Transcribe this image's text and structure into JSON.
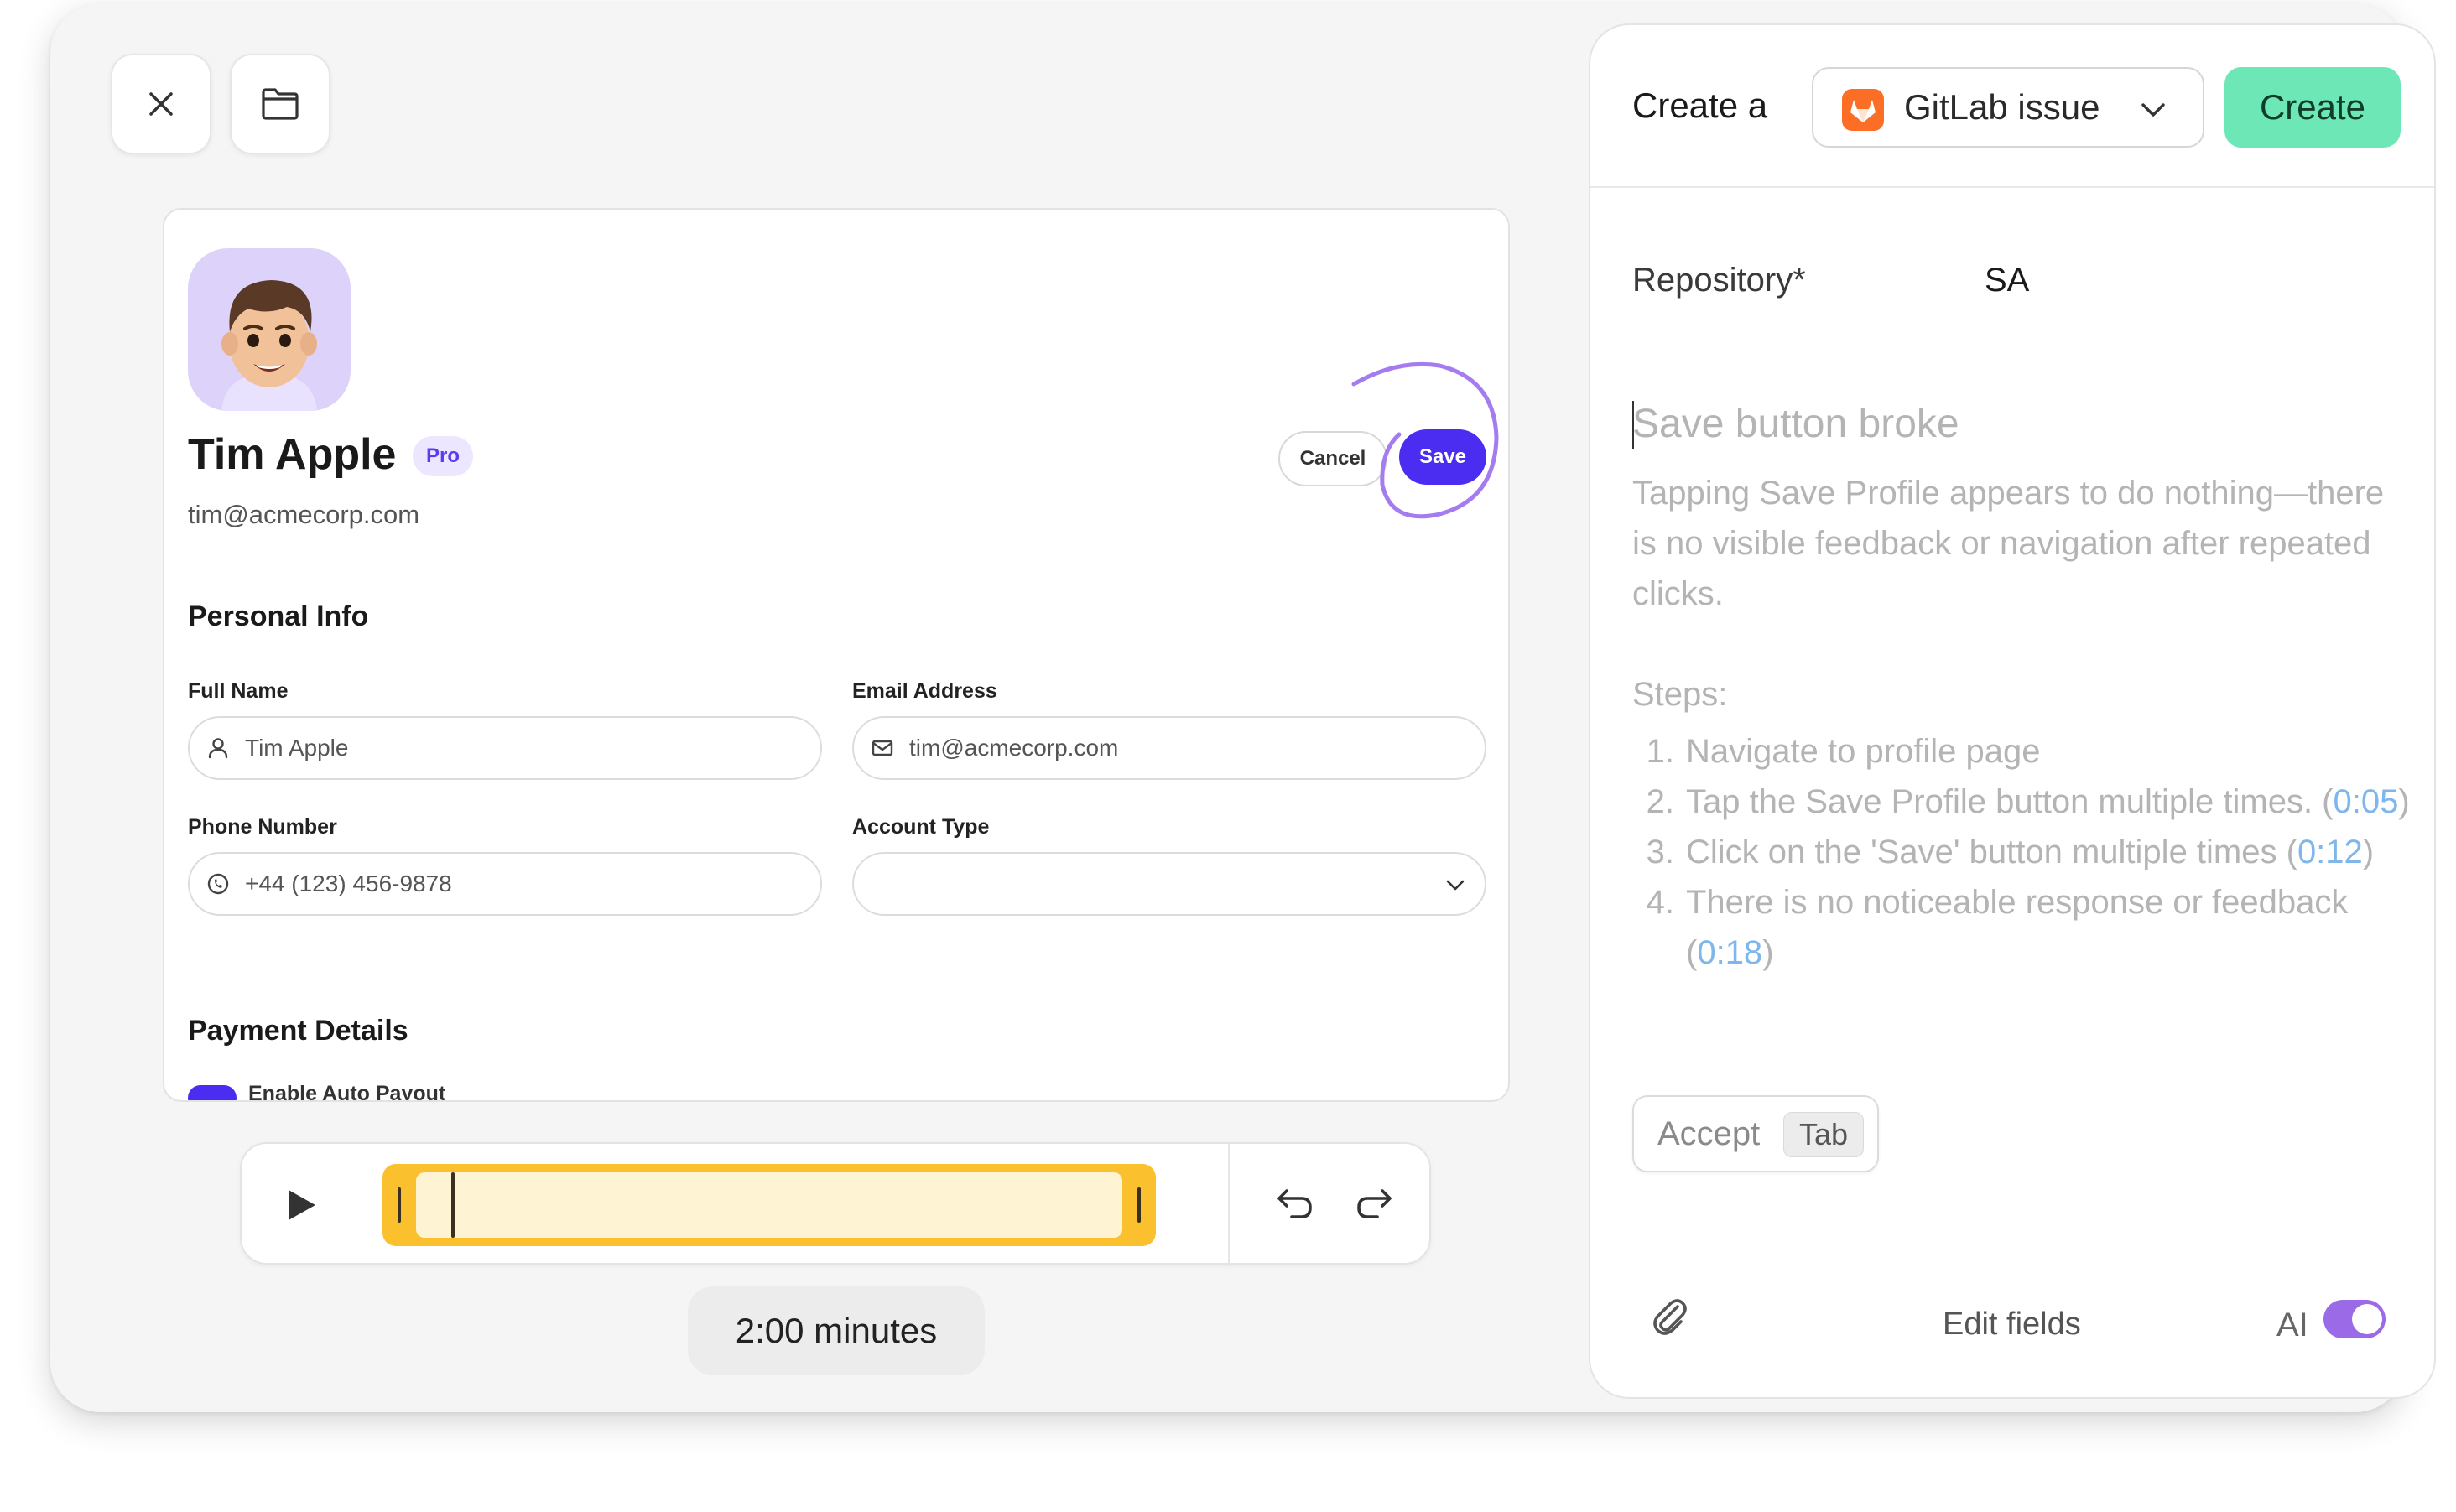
{
  "toolbar": {
    "close_icon": "close-icon",
    "folder_icon": "folder-icon"
  },
  "profile": {
    "name": "Tim Apple",
    "badge": "Pro",
    "email": "tim@acmecorp.com",
    "cancel_label": "Cancel",
    "save_label": "Save"
  },
  "personal_info": {
    "heading": "Personal Info",
    "full_name_label": "Full Name",
    "full_name_value": "Tim Apple",
    "email_label": "Email Address",
    "email_value": "tim@acmecorp.com",
    "phone_label": "Phone Number",
    "phone_value": "+44 (123) 456-9878",
    "account_type_label": "Account Type",
    "account_type_value": ""
  },
  "payment": {
    "heading": "Payment Details",
    "auto_payout_label": "Enable Auto Payout"
  },
  "player": {
    "duration": "2:00 minutes",
    "playhead_fraction": 0.05
  },
  "issue_panel": {
    "create_prefix": "Create a",
    "issue_type": "GitLab issue",
    "create_label": "Create",
    "repository_label": "Repository*",
    "repository_value": "SA",
    "title_placeholder": "Save button broke",
    "description": "Tapping Save Profile appears to do nothing—there is no visible feedback or navigation after repeated clicks.",
    "steps_label": "Steps:",
    "steps": [
      {
        "num": "1.",
        "text": "Navigate to profile page",
        "ts": ""
      },
      {
        "num": "2.",
        "text": "Tap the Save Profile button multiple times.",
        "ts": "0:05"
      },
      {
        "num": "3.",
        "text": "Click on the 'Save' button multiple times",
        "ts": "0:12"
      },
      {
        "num": "4.",
        "text": "There is no noticeable response or feedback",
        "ts": "0:18"
      }
    ],
    "accept_label": "Accept",
    "accept_key": "Tab",
    "edit_fields_label": "Edit fields",
    "ai_label": "AI",
    "ai_enabled": true
  },
  "colors": {
    "accent_purple": "#4a2df0",
    "create_green": "#6ee7b7",
    "timeline_yellow": "#fbc02d",
    "timestamp_blue": "#7fb6ec",
    "ai_toggle": "#9b6ae6",
    "gitlab_orange": "#fc6d26"
  }
}
